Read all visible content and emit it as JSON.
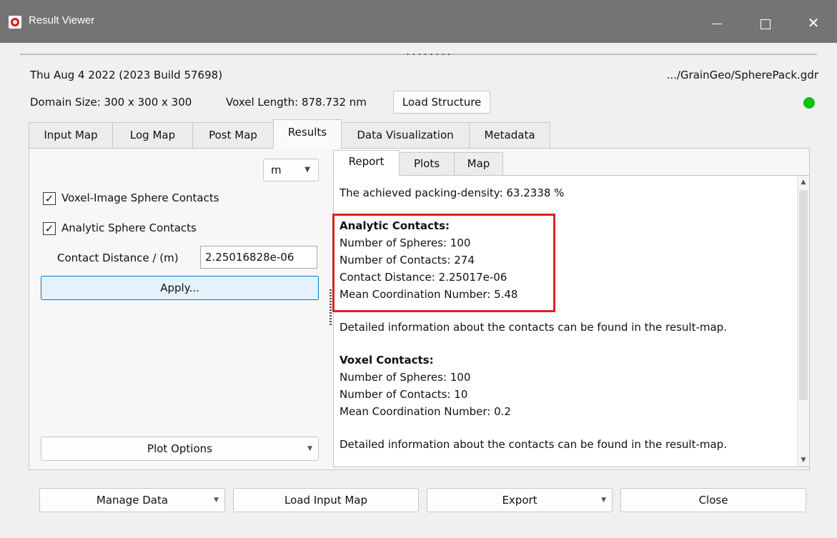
{
  "window": {
    "title": "Result Viewer",
    "icon": "app-logo-icon",
    "controls": [
      "minimize-icon",
      "maximize-icon",
      "close-icon"
    ],
    "splitter_handle": "........"
  },
  "header": {
    "date": "Thu Aug 4 2022 (2023 Build 57698)",
    "path": ".../GrainGeo/SpherePack.gdr",
    "domain_size": "Domain Size: 300 x 300 x 300",
    "voxel_length": "Voxel Length: 878.732 nm",
    "load_structure_label": "Load Structure",
    "status_color": "#11c011"
  },
  "tabs": [
    {
      "label": "Input Map",
      "active": false
    },
    {
      "label": "Log Map",
      "active": false
    },
    {
      "label": "Post Map",
      "active": false
    },
    {
      "label": "Results",
      "active": true
    },
    {
      "label": "Data Visualization",
      "active": false
    },
    {
      "label": "Metadata",
      "active": false
    }
  ],
  "left_panel": {
    "unit": "m",
    "voxel_contacts": {
      "label": "Voxel-Image Sphere Contacts",
      "checked": true,
      "mark": "✓"
    },
    "analytic_contacts": {
      "label": "Analytic Sphere Contacts",
      "checked": true,
      "mark": "✓"
    },
    "contact_distance_label": "Contact Distance / (m)",
    "contact_distance_value": "2.25016828e-06",
    "apply_label": "Apply...",
    "plot_options_label": "Plot Options"
  },
  "subtabs": [
    {
      "label": "Report",
      "active": true
    },
    {
      "label": "Plots",
      "active": false
    },
    {
      "label": "Map",
      "active": false
    }
  ],
  "report": {
    "packing": "The achieved packing-density: 63.2338 %",
    "analytic_heading": "Analytic Contacts:",
    "analytic_spheres": "Number of Spheres: 100",
    "analytic_contacts": "Number of Contacts: 274",
    "analytic_distance": "Contact Distance: 2.25017e-06",
    "analytic_mean": "Mean Coordination Number: 5.48",
    "detail_1": "Detailed information about the contacts can be found in the result-map.",
    "voxel_heading": "Voxel Contacts:",
    "voxel_spheres": "Number of Spheres: 100",
    "voxel_contacts": "Number of Contacts: 10",
    "voxel_mean": "Mean Coordination Number: 0.2",
    "detail_2": "Detailed information about the contacts can be found in the result-map.",
    "highlight_color": "#e02020"
  },
  "footer": {
    "manage_data": "Manage Data",
    "load_input_map": "Load Input Map",
    "export": "Export",
    "close": "Close"
  }
}
